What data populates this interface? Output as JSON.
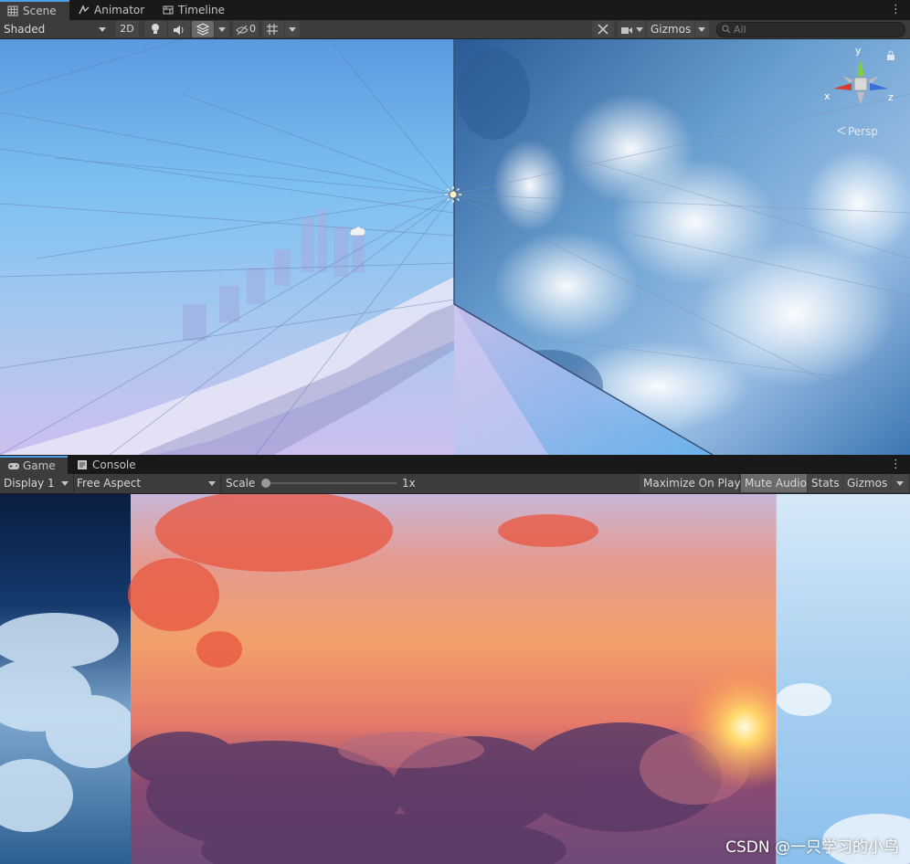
{
  "scene_tabs": [
    {
      "label": "Scene",
      "icon": "grid-icon",
      "active": true
    },
    {
      "label": "Animator",
      "icon": "animator-icon",
      "active": false
    },
    {
      "label": "Timeline",
      "icon": "timeline-icon",
      "active": false
    }
  ],
  "scene_toolbar": {
    "shading_mode": "Shaded",
    "mode_2d": "2D",
    "hidden_count": "0",
    "gizmos": "Gizmos",
    "search_placeholder": "All",
    "icons": [
      "light-icon",
      "audio-icon",
      "effects-icon",
      "visibility-icon",
      "grid-snap-icon",
      "tools-icon",
      "camera-icon",
      "search-icon",
      "lock-icon"
    ]
  },
  "scene_view": {
    "gizmo_axes": {
      "x": "x",
      "y": "y",
      "z": "z"
    },
    "projection": "Persp",
    "colors": {
      "x_axis": "#d3402f",
      "y_axis": "#82cf3a",
      "z_axis": "#3a6fd8"
    }
  },
  "game_tabs": [
    {
      "label": "Game",
      "icon": "gamepad-icon",
      "active": true
    },
    {
      "label": "Console",
      "icon": "console-icon",
      "active": false
    }
  ],
  "game_toolbar": {
    "display": "Display 1",
    "aspect": "Free Aspect",
    "scale_label": "Scale",
    "scale_value": "1x",
    "scale_level": 0.0,
    "maximize": "Maximize On Play",
    "mute": "Mute Audio",
    "stats": "Stats",
    "gizmos": "Gizmos"
  },
  "watermark": "CSDN @一只学习的小鸟",
  "colors": {
    "accent": "#4d9fe4",
    "panel": "#3c3c3c",
    "background": "#191919"
  }
}
